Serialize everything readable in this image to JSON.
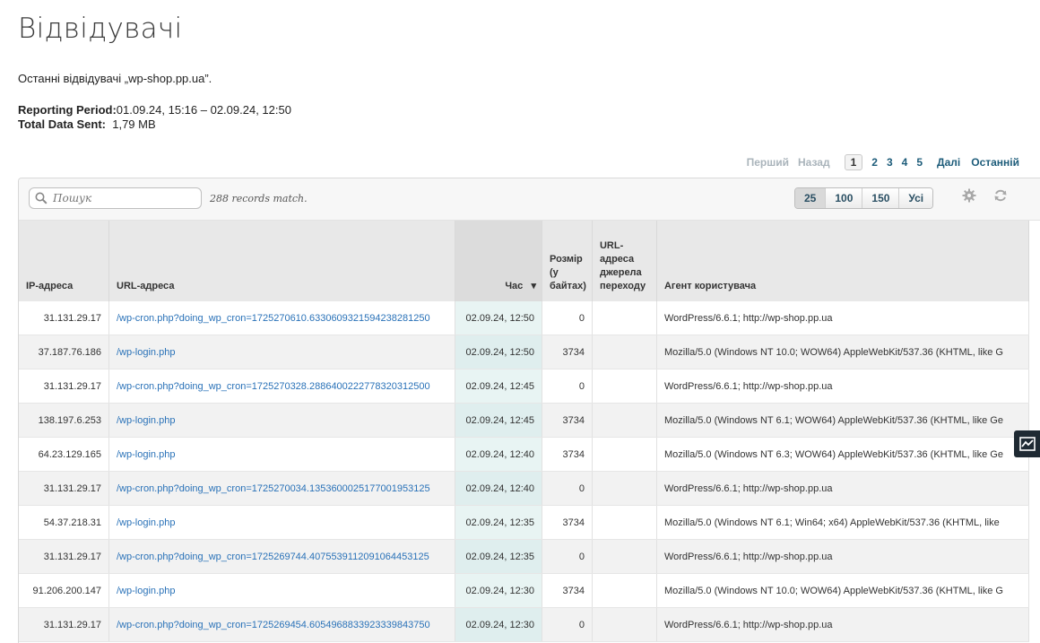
{
  "page": {
    "title": "Відвідувачі",
    "subtitle": "Останні відвідувачі „wp-shop.pp.ua”.",
    "reporting_label": "Reporting Period:",
    "reporting_value": "01.09.24, 15:16  –  02.09.24, 12:50",
    "total_label": "Total Data Sent:",
    "total_value": "1,79 MB"
  },
  "pagination": {
    "first": "Перший",
    "prev": "Назад",
    "pages": [
      "1",
      "2",
      "3",
      "4",
      "5"
    ],
    "current": "1",
    "next": "Далі",
    "last": "Останній"
  },
  "toolbar": {
    "search_placeholder": "Пошук",
    "records_match": "288 records match.",
    "page_sizes": [
      "25",
      "100",
      "150",
      "Усі"
    ],
    "selected_page_size": "25",
    "icons": [
      "search-icon",
      "gear-icon",
      "refresh-icon",
      "chart-icon"
    ]
  },
  "table": {
    "columns": [
      "IP-адреса",
      "URL-адреса",
      "Час",
      "Розмір (у байтах)",
      "URL-адреса джерела переходу",
      "Агент користувача"
    ],
    "sorted_column": "Час",
    "rows": [
      {
        "ip": "31.131.29.17",
        "url": "/wp-cron.php?doing_wp_cron=1725270610.6330609321594238281250",
        "time": "02.09.24, 12:50",
        "size": "0",
        "referrer": "",
        "agent": "WordPress/6.6.1; http://wp-shop.pp.ua"
      },
      {
        "ip": "37.187.76.186",
        "url": "/wp-login.php",
        "time": "02.09.24, 12:50",
        "size": "3734",
        "referrer": "",
        "agent": "Mozilla/5.0 (Windows NT 10.0; WOW64) AppleWebKit/537.36 (KHTML, like G"
      },
      {
        "ip": "31.131.29.17",
        "url": "/wp-cron.php?doing_wp_cron=1725270328.2886400222778320312500",
        "time": "02.09.24, 12:45",
        "size": "0",
        "referrer": "",
        "agent": "WordPress/6.6.1; http://wp-shop.pp.ua"
      },
      {
        "ip": "138.197.6.253",
        "url": "/wp-login.php",
        "time": "02.09.24, 12:45",
        "size": "3734",
        "referrer": "",
        "agent": "Mozilla/5.0 (Windows NT 6.1; WOW64) AppleWebKit/537.36 (KHTML, like Ge"
      },
      {
        "ip": "64.23.129.165",
        "url": "/wp-login.php",
        "time": "02.09.24, 12:40",
        "size": "3734",
        "referrer": "",
        "agent": "Mozilla/5.0 (Windows NT 6.3; WOW64) AppleWebKit/537.36 (KHTML, like Ge"
      },
      {
        "ip": "31.131.29.17",
        "url": "/wp-cron.php?doing_wp_cron=1725270034.1353600025177001953125",
        "time": "02.09.24, 12:40",
        "size": "0",
        "referrer": "",
        "agent": "WordPress/6.6.1; http://wp-shop.pp.ua"
      },
      {
        "ip": "54.37.218.31",
        "url": "/wp-login.php",
        "time": "02.09.24, 12:35",
        "size": "3734",
        "referrer": "",
        "agent": "Mozilla/5.0 (Windows NT 6.1; Win64; x64) AppleWebKit/537.36 (KHTML, like"
      },
      {
        "ip": "31.131.29.17",
        "url": "/wp-cron.php?doing_wp_cron=1725269744.4075539112091064453125",
        "time": "02.09.24, 12:35",
        "size": "0",
        "referrer": "",
        "agent": "WordPress/6.6.1; http://wp-shop.pp.ua"
      },
      {
        "ip": "91.206.200.147",
        "url": "/wp-login.php",
        "time": "02.09.24, 12:30",
        "size": "3734",
        "referrer": "",
        "agent": "Mozilla/5.0 (Windows NT 10.0; WOW64) AppleWebKit/537.36 (KHTML, like G"
      },
      {
        "ip": "31.131.29.17",
        "url": "/wp-cron.php?doing_wp_cron=1725269454.6054968833923339843750",
        "time": "02.09.24, 12:30",
        "size": "0",
        "referrer": "",
        "agent": "WordPress/6.6.1; http://wp-shop.pp.ua"
      }
    ]
  }
}
